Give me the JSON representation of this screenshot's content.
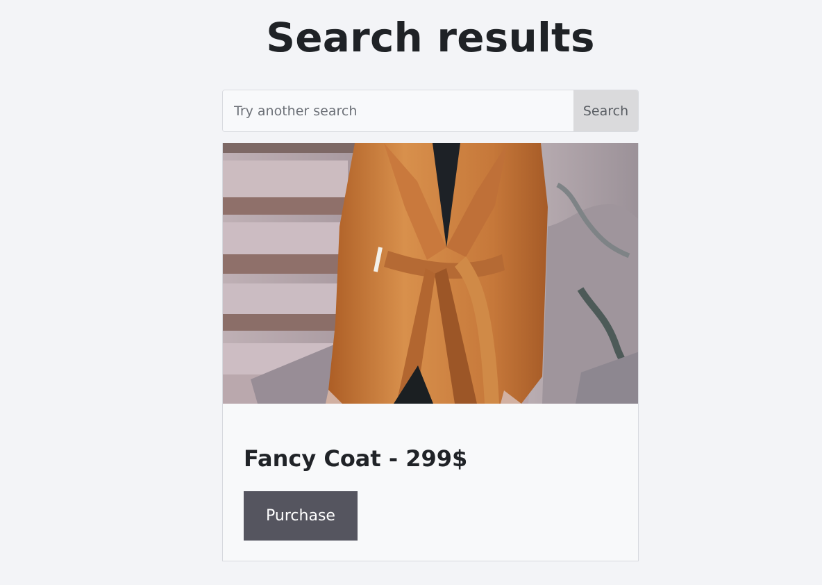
{
  "page": {
    "title": "Search results"
  },
  "search": {
    "placeholder": "Try another search",
    "value": "",
    "button_label": "Search"
  },
  "results": [
    {
      "title": "Fancy Coat - 299$",
      "purchase_label": "Purchase",
      "image": "product-photo-icon"
    }
  ],
  "colors": {
    "background": "#f3f4f7",
    "card_background": "#f8f9fa",
    "title_text": "#1f2226",
    "search_button_background": "#dadadc",
    "purchase_button_background": "#55555f",
    "coat": "#c77737"
  }
}
